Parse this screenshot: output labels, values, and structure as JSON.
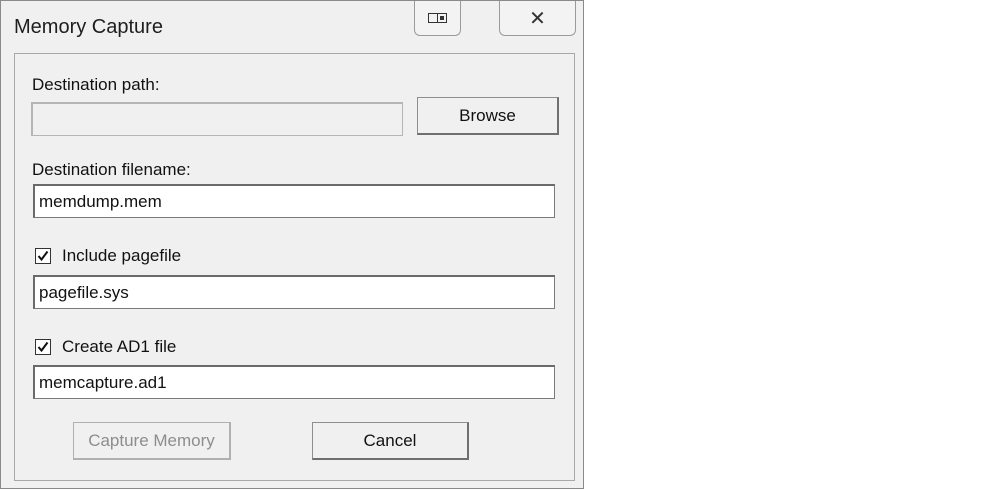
{
  "window": {
    "title": "Memory Capture",
    "restore_icon": "restore-icon",
    "close_icon": "close-icon",
    "close_glyph": "✕"
  },
  "form": {
    "dest_path_label": "Destination path:",
    "dest_path_value": "",
    "browse_label": "Browse",
    "dest_filename_label": "Destination filename:",
    "dest_filename_value": "memdump.mem",
    "include_pagefile": {
      "label": "Include pagefile",
      "checked": true
    },
    "pagefile_value": "pagefile.sys",
    "create_ad1": {
      "label": "Create AD1 file",
      "checked": true
    },
    "ad1_value": "memcapture.ad1"
  },
  "actions": {
    "capture_label": "Capture Memory",
    "capture_enabled": false,
    "cancel_label": "Cancel"
  }
}
